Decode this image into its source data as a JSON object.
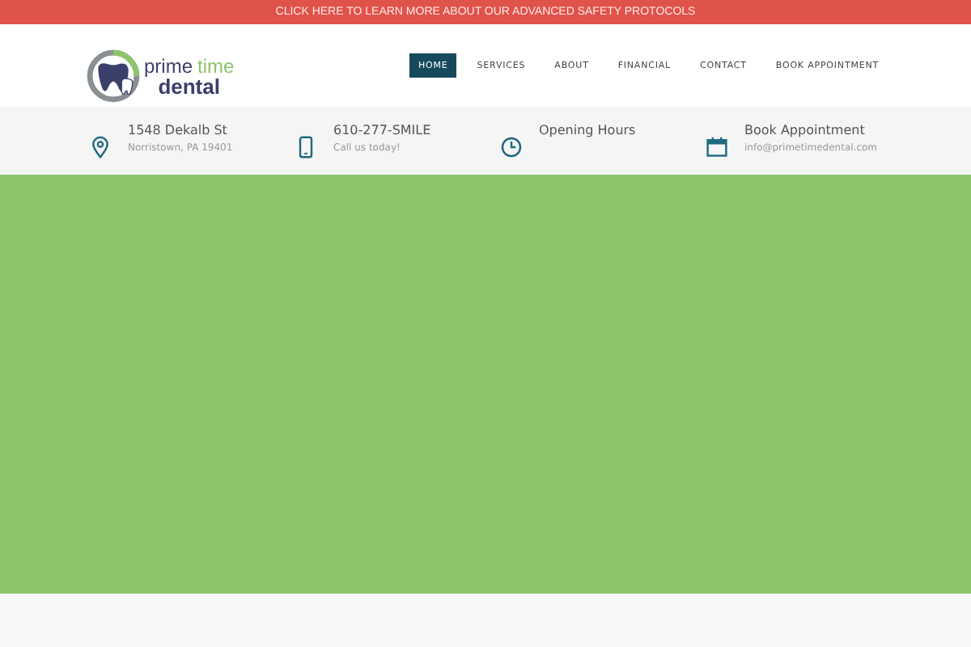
{
  "announcement": "CLICK HERE TO LEARN MORE ABOUT OUR ADVANCED SAFETY PROTOCOLS",
  "logo": {
    "word_1": "prime",
    "word_2": "time",
    "word_3": "dental"
  },
  "nav": [
    {
      "label": "HOME",
      "selected": true
    },
    {
      "label": "SERVICES",
      "selected": false
    },
    {
      "label": "ABOUT",
      "selected": false
    },
    {
      "label": "FINANCIAL",
      "selected": false
    },
    {
      "label": "CONTACT",
      "selected": false
    },
    {
      "label": "BOOK APPOINTMENT",
      "selected": false
    }
  ],
  "info": [
    {
      "kind": "location",
      "title": "1548 Dekalb St",
      "subtitle": "Norristown, PA 19401"
    },
    {
      "kind": "phone",
      "title": "610-277-SMILE",
      "subtitle": "Call us today!"
    },
    {
      "kind": "clock",
      "title": "Opening Hours"
    },
    {
      "kind": "calendar",
      "title": "Book Appointment",
      "subtitle": "info@primetimedental.com"
    }
  ]
}
